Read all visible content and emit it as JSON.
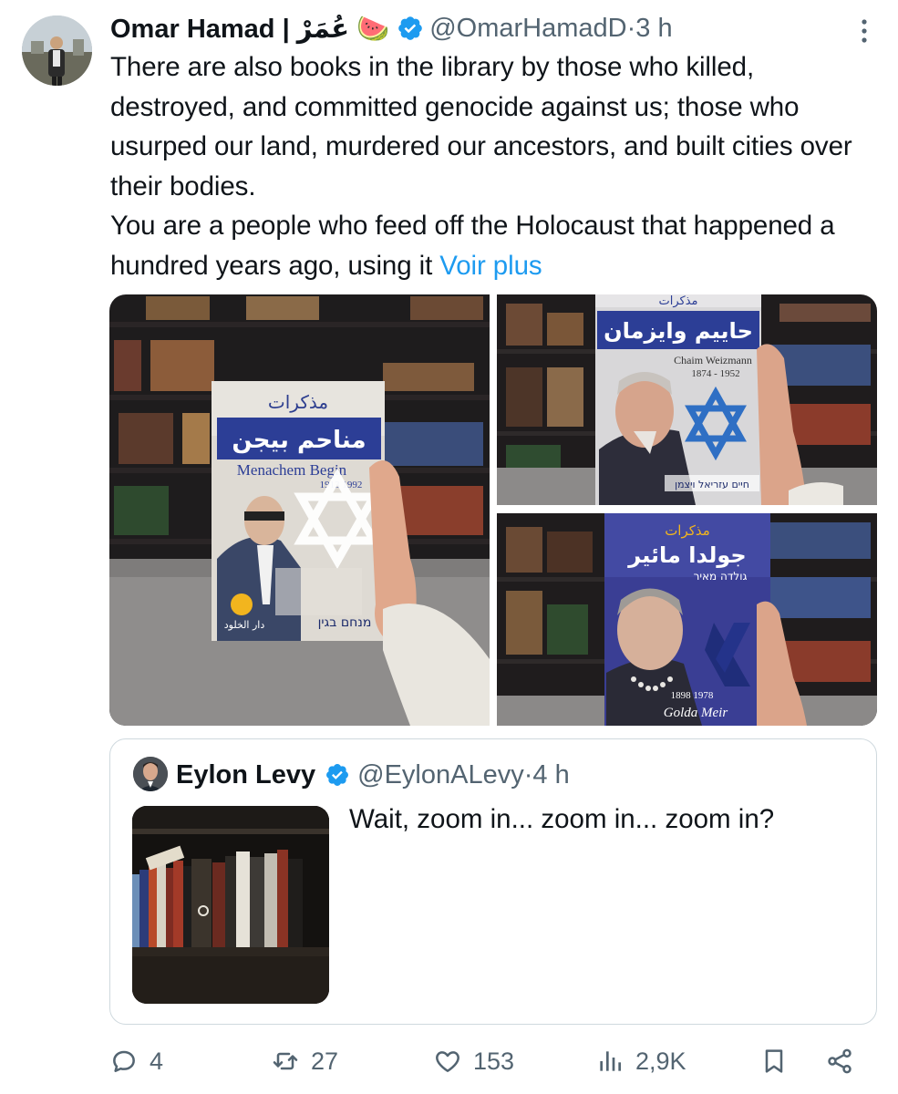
{
  "tweet": {
    "author_name": "Omar Hamad | عُمَرْ 🍉",
    "handle": "@OmarHamadD",
    "separator": " · ",
    "time": "3 h",
    "text_paragraph_1": "There are also books in the library by those who killed, destroyed, and committed genocide against us; those who usurped our land, murdered our ancestors, and built cities over their bodies.",
    "text_paragraph_2": "You are a people who feed off the Holocaust that happened a hundred years ago, using it ",
    "show_more": "Voir plus",
    "icons": {
      "verified": "verified-badge-icon",
      "more": "more-options-icon"
    }
  },
  "media": {
    "book1": {
      "arabic_top": "مذكرات",
      "arabic_title": "مناحم بيجن",
      "latin_title": "Menachem Begin",
      "years": "1913 1992",
      "hebrew": "מנחם בגין",
      "publisher": "دار الخلود"
    },
    "book2": {
      "arabic_top": "مذكرات",
      "arabic_title": "حاييم وايزمان",
      "latin_title": "Chaim Weizmann",
      "years": "1874 - 1952",
      "hebrew": "חיים עזריאל ויצמן"
    },
    "book3": {
      "arabic_top": "مذكرات",
      "arabic_title": "جولدا مائير",
      "hebrew": "גולדה מאיר",
      "years": "1898 1978",
      "latin_title": "Golda Meir"
    }
  },
  "quote": {
    "author_name": "Eylon Levy",
    "handle": "@EylonALevy",
    "separator": " · ",
    "time": "4 h",
    "text": "Wait, zoom in... zoom in... zoom in?"
  },
  "actions": {
    "reply_count": "4",
    "retweet_count": "27",
    "like_count": "153",
    "views_count": "2,9K",
    "icons": [
      "reply-icon",
      "retweet-icon",
      "like-icon",
      "views-icon",
      "bookmark-icon",
      "share-icon"
    ]
  },
  "colors": {
    "text": "#0f1419",
    "secondary": "#536471",
    "link": "#1d9bf0",
    "border": "#cfd9de"
  }
}
